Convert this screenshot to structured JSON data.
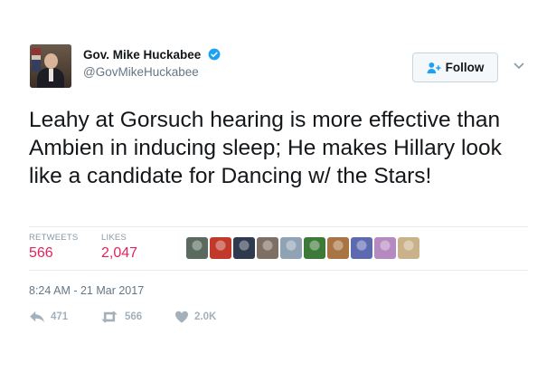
{
  "user": {
    "name": "Gov. Mike Huckabee",
    "handle": "@GovMikeHuckabee",
    "verified": true
  },
  "follow_button": {
    "label": "Follow"
  },
  "tweet": {
    "text": "Leahy at Gorsuch hearing is more effective than Ambien in inducing sleep; He makes Hillary look like a candidate for Dancing w/ the Stars!",
    "timestamp": "8:24 AM - 21 Mar 2017"
  },
  "stats": {
    "retweets_label": "RETWEETS",
    "retweets_value": "566",
    "likes_label": "LIKES",
    "likes_value": "2,047"
  },
  "likers": {
    "count": 10,
    "colors": [
      "#5a6a5e",
      "#c0392b",
      "#2f3a4f",
      "#7d6f63",
      "#8fa3b5",
      "#3d7a3a",
      "#a87443",
      "#5d6ab0",
      "#b48ac0",
      "#c9b28a"
    ]
  },
  "actions": {
    "reply_count": "471",
    "retweet_count": "566",
    "like_count": "2.0K"
  },
  "colors": {
    "text": "#14171a",
    "secondary": "#657786",
    "verified": "#1da1f2",
    "stat_red": "#e0245e",
    "action_gray": "#a4b1ba"
  },
  "icons": {
    "verified": "verified-badge-icon",
    "follow": "add-user-icon",
    "menu": "chevron-down-icon",
    "reply": "reply-icon",
    "retweet": "retweet-icon",
    "like": "heart-icon"
  }
}
